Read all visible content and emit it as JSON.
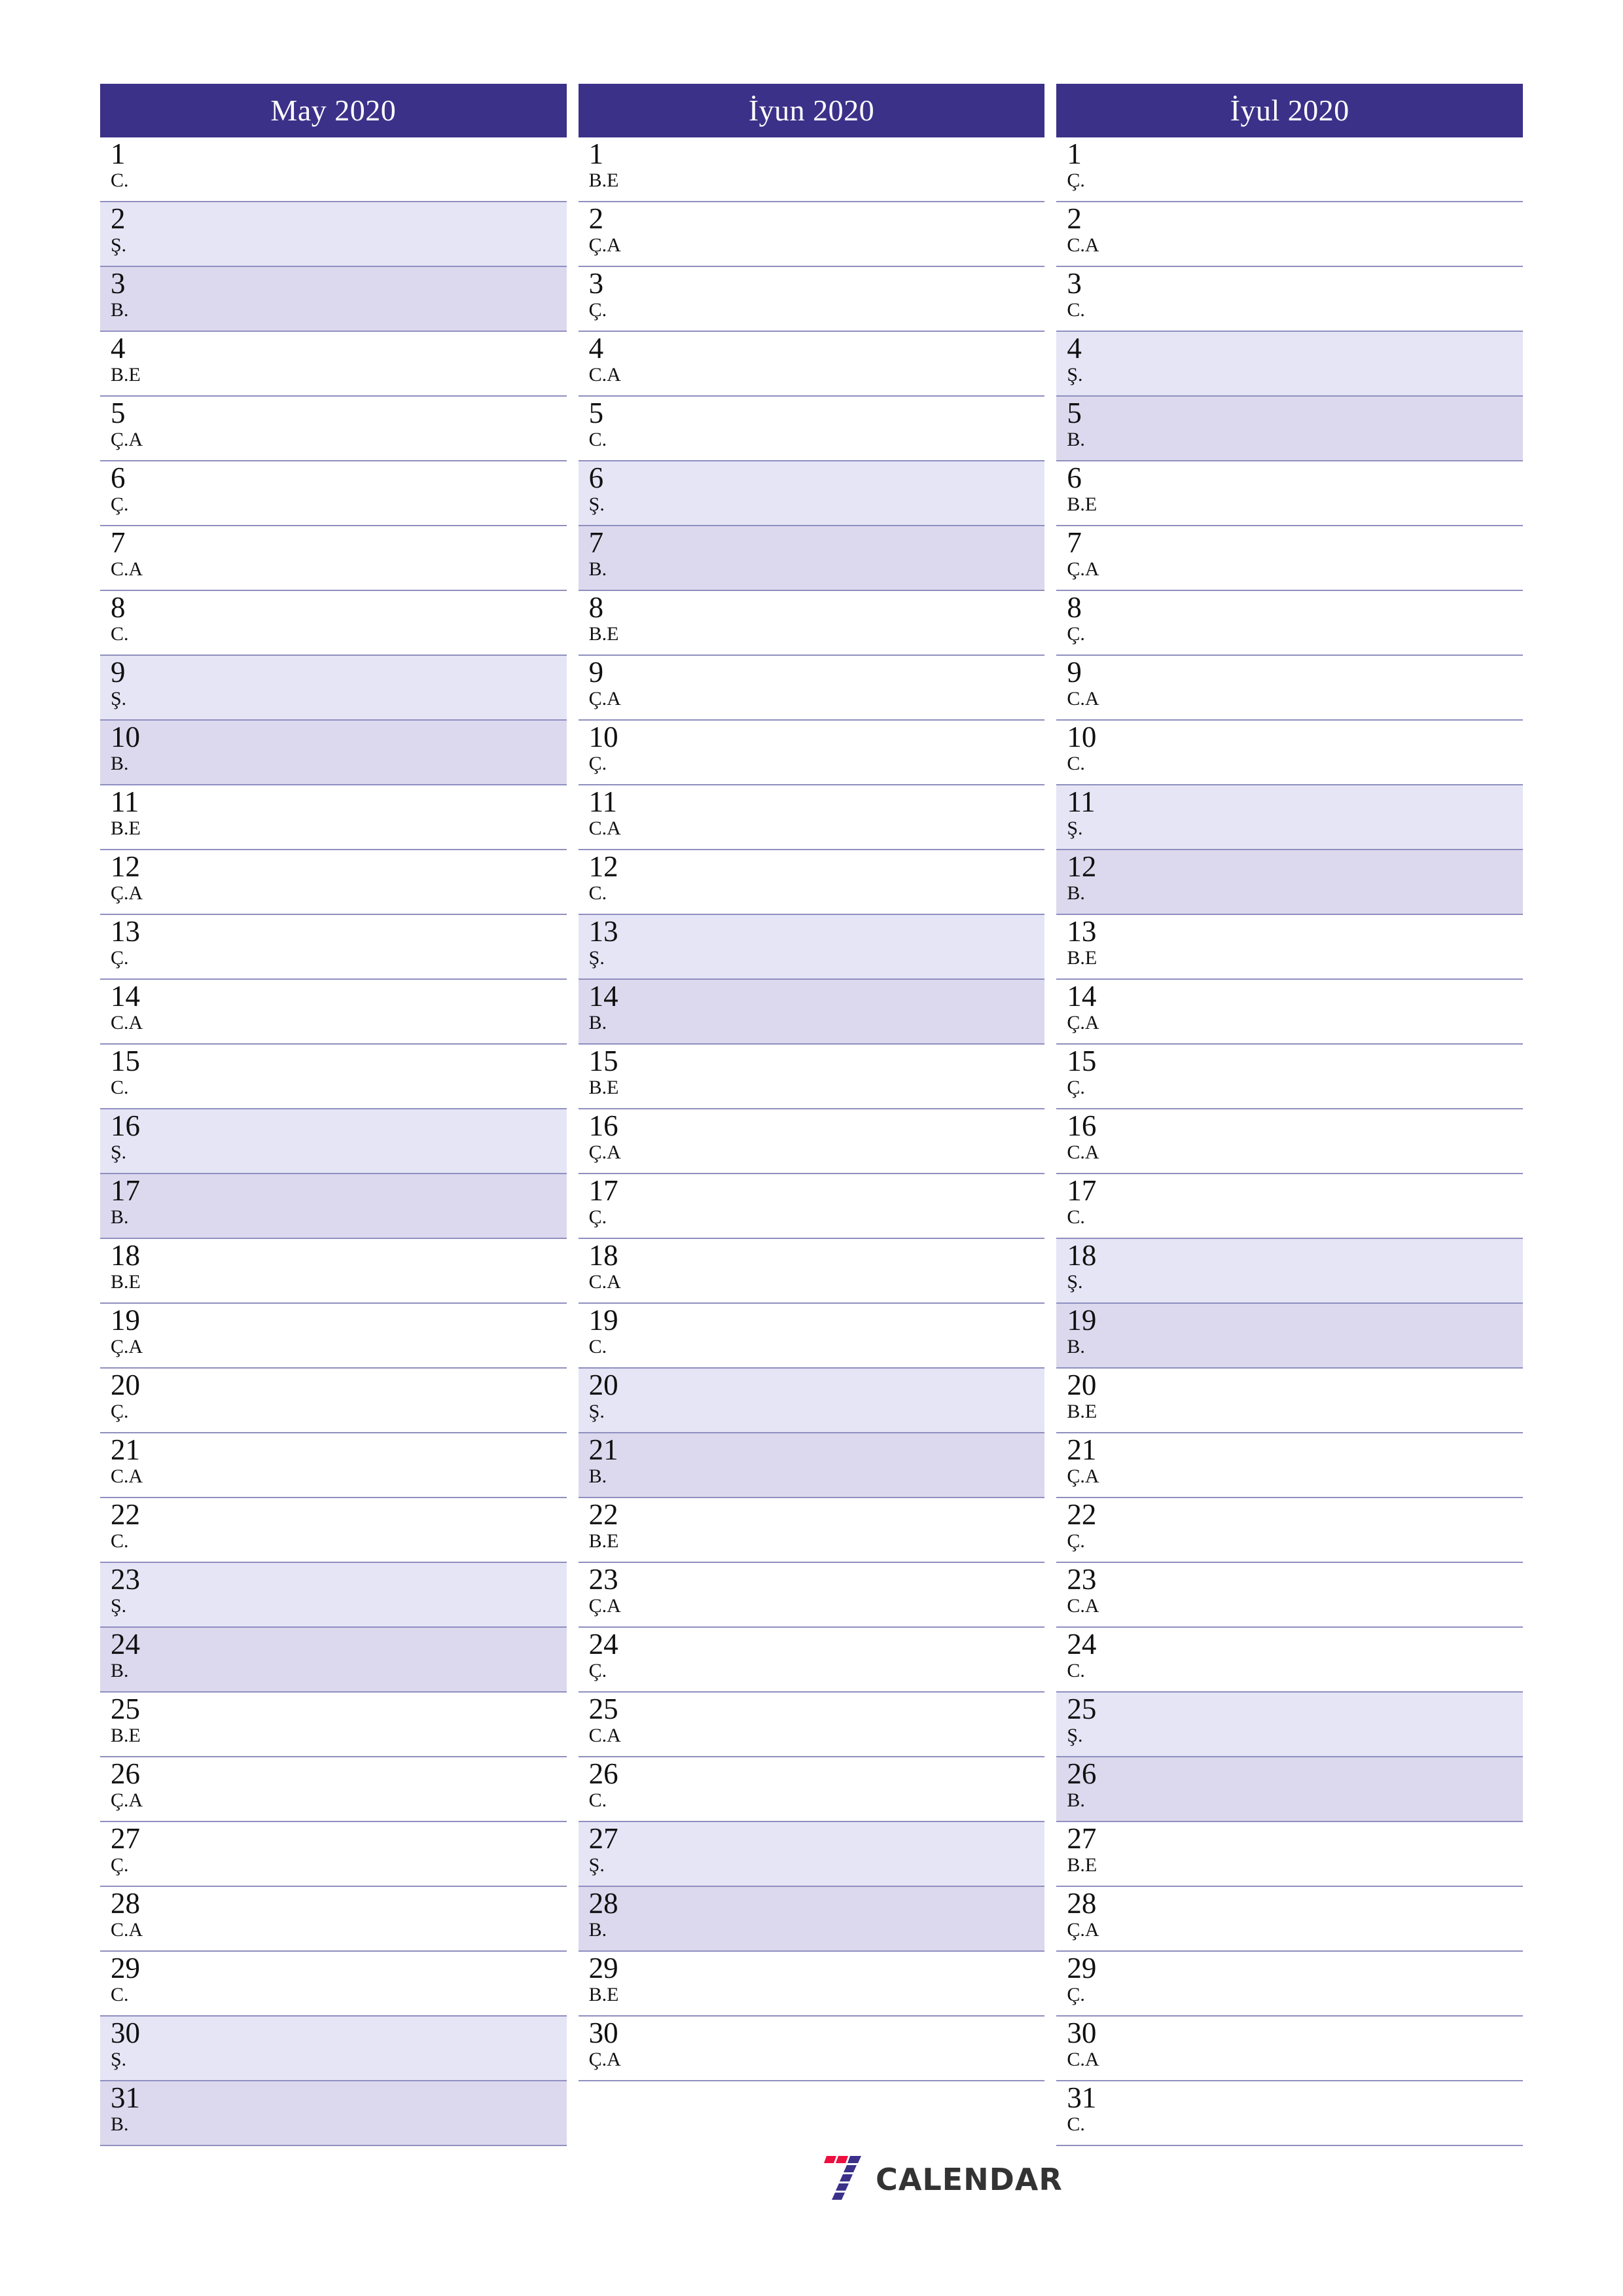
{
  "page": {
    "background_color": "#ffffff",
    "header_color": "#3b3189",
    "saturday_color": "#e5e5f6",
    "sunday_color": "#dcd9ee",
    "separator_color": "#8f8fc0"
  },
  "footer": {
    "logo_text": "CALENDAR",
    "logo_mark_name": "seven-calendar-logo",
    "logo_red": "#ec0f3f",
    "logo_indigo": "#3b3189"
  },
  "months": [
    {
      "title": "May 2020",
      "days": [
        {
          "num": "1",
          "wd": "C.",
          "type": "weekday"
        },
        {
          "num": "2",
          "wd": "Ş.",
          "type": "sat"
        },
        {
          "num": "3",
          "wd": "B.",
          "type": "sun"
        },
        {
          "num": "4",
          "wd": "B.E",
          "type": "weekday"
        },
        {
          "num": "5",
          "wd": "Ç.A",
          "type": "weekday"
        },
        {
          "num": "6",
          "wd": "Ç.",
          "type": "weekday"
        },
        {
          "num": "7",
          "wd": "C.A",
          "type": "weekday"
        },
        {
          "num": "8",
          "wd": "C.",
          "type": "weekday"
        },
        {
          "num": "9",
          "wd": "Ş.",
          "type": "sat"
        },
        {
          "num": "10",
          "wd": "B.",
          "type": "sun"
        },
        {
          "num": "11",
          "wd": "B.E",
          "type": "weekday"
        },
        {
          "num": "12",
          "wd": "Ç.A",
          "type": "weekday"
        },
        {
          "num": "13",
          "wd": "Ç.",
          "type": "weekday"
        },
        {
          "num": "14",
          "wd": "C.A",
          "type": "weekday"
        },
        {
          "num": "15",
          "wd": "C.",
          "type": "weekday"
        },
        {
          "num": "16",
          "wd": "Ş.",
          "type": "sat"
        },
        {
          "num": "17",
          "wd": "B.",
          "type": "sun"
        },
        {
          "num": "18",
          "wd": "B.E",
          "type": "weekday"
        },
        {
          "num": "19",
          "wd": "Ç.A",
          "type": "weekday"
        },
        {
          "num": "20",
          "wd": "Ç.",
          "type": "weekday"
        },
        {
          "num": "21",
          "wd": "C.A",
          "type": "weekday"
        },
        {
          "num": "22",
          "wd": "C.",
          "type": "weekday"
        },
        {
          "num": "23",
          "wd": "Ş.",
          "type": "sat"
        },
        {
          "num": "24",
          "wd": "B.",
          "type": "sun"
        },
        {
          "num": "25",
          "wd": "B.E",
          "type": "weekday"
        },
        {
          "num": "26",
          "wd": "Ç.A",
          "type": "weekday"
        },
        {
          "num": "27",
          "wd": "Ç.",
          "type": "weekday"
        },
        {
          "num": "28",
          "wd": "C.A",
          "type": "weekday"
        },
        {
          "num": "29",
          "wd": "C.",
          "type": "weekday"
        },
        {
          "num": "30",
          "wd": "Ş.",
          "type": "sat"
        },
        {
          "num": "31",
          "wd": "B.",
          "type": "sun"
        }
      ]
    },
    {
      "title": "İyun 2020",
      "days": [
        {
          "num": "1",
          "wd": "B.E",
          "type": "weekday"
        },
        {
          "num": "2",
          "wd": "Ç.A",
          "type": "weekday"
        },
        {
          "num": "3",
          "wd": "Ç.",
          "type": "weekday"
        },
        {
          "num": "4",
          "wd": "C.A",
          "type": "weekday"
        },
        {
          "num": "5",
          "wd": "C.",
          "type": "weekday"
        },
        {
          "num": "6",
          "wd": "Ş.",
          "type": "sat"
        },
        {
          "num": "7",
          "wd": "B.",
          "type": "sun"
        },
        {
          "num": "8",
          "wd": "B.E",
          "type": "weekday"
        },
        {
          "num": "9",
          "wd": "Ç.A",
          "type": "weekday"
        },
        {
          "num": "10",
          "wd": "Ç.",
          "type": "weekday"
        },
        {
          "num": "11",
          "wd": "C.A",
          "type": "weekday"
        },
        {
          "num": "12",
          "wd": "C.",
          "type": "weekday"
        },
        {
          "num": "13",
          "wd": "Ş.",
          "type": "sat"
        },
        {
          "num": "14",
          "wd": "B.",
          "type": "sun"
        },
        {
          "num": "15",
          "wd": "B.E",
          "type": "weekday"
        },
        {
          "num": "16",
          "wd": "Ç.A",
          "type": "weekday"
        },
        {
          "num": "17",
          "wd": "Ç.",
          "type": "weekday"
        },
        {
          "num": "18",
          "wd": "C.A",
          "type": "weekday"
        },
        {
          "num": "19",
          "wd": "C.",
          "type": "weekday"
        },
        {
          "num": "20",
          "wd": "Ş.",
          "type": "sat"
        },
        {
          "num": "21",
          "wd": "B.",
          "type": "sun"
        },
        {
          "num": "22",
          "wd": "B.E",
          "type": "weekday"
        },
        {
          "num": "23",
          "wd": "Ç.A",
          "type": "weekday"
        },
        {
          "num": "24",
          "wd": "Ç.",
          "type": "weekday"
        },
        {
          "num": "25",
          "wd": "C.A",
          "type": "weekday"
        },
        {
          "num": "26",
          "wd": "C.",
          "type": "weekday"
        },
        {
          "num": "27",
          "wd": "Ş.",
          "type": "sat"
        },
        {
          "num": "28",
          "wd": "B.",
          "type": "sun"
        },
        {
          "num": "29",
          "wd": "B.E",
          "type": "weekday"
        },
        {
          "num": "30",
          "wd": "Ç.A",
          "type": "weekday"
        }
      ]
    },
    {
      "title": "İyul 2020",
      "days": [
        {
          "num": "1",
          "wd": "Ç.",
          "type": "weekday"
        },
        {
          "num": "2",
          "wd": "C.A",
          "type": "weekday"
        },
        {
          "num": "3",
          "wd": "C.",
          "type": "weekday"
        },
        {
          "num": "4",
          "wd": "Ş.",
          "type": "sat"
        },
        {
          "num": "5",
          "wd": "B.",
          "type": "sun"
        },
        {
          "num": "6",
          "wd": "B.E",
          "type": "weekday"
        },
        {
          "num": "7",
          "wd": "Ç.A",
          "type": "weekday"
        },
        {
          "num": "8",
          "wd": "Ç.",
          "type": "weekday"
        },
        {
          "num": "9",
          "wd": "C.A",
          "type": "weekday"
        },
        {
          "num": "10",
          "wd": "C.",
          "type": "weekday"
        },
        {
          "num": "11",
          "wd": "Ş.",
          "type": "sat"
        },
        {
          "num": "12",
          "wd": "B.",
          "type": "sun"
        },
        {
          "num": "13",
          "wd": "B.E",
          "type": "weekday"
        },
        {
          "num": "14",
          "wd": "Ç.A",
          "type": "weekday"
        },
        {
          "num": "15",
          "wd": "Ç.",
          "type": "weekday"
        },
        {
          "num": "16",
          "wd": "C.A",
          "type": "weekday"
        },
        {
          "num": "17",
          "wd": "C.",
          "type": "weekday"
        },
        {
          "num": "18",
          "wd": "Ş.",
          "type": "sat"
        },
        {
          "num": "19",
          "wd": "B.",
          "type": "sun"
        },
        {
          "num": "20",
          "wd": "B.E",
          "type": "weekday"
        },
        {
          "num": "21",
          "wd": "Ç.A",
          "type": "weekday"
        },
        {
          "num": "22",
          "wd": "Ç.",
          "type": "weekday"
        },
        {
          "num": "23",
          "wd": "C.A",
          "type": "weekday"
        },
        {
          "num": "24",
          "wd": "C.",
          "type": "weekday"
        },
        {
          "num": "25",
          "wd": "Ş.",
          "type": "sat"
        },
        {
          "num": "26",
          "wd": "B.",
          "type": "sun"
        },
        {
          "num": "27",
          "wd": "B.E",
          "type": "weekday"
        },
        {
          "num": "28",
          "wd": "Ç.A",
          "type": "weekday"
        },
        {
          "num": "29",
          "wd": "Ç.",
          "type": "weekday"
        },
        {
          "num": "30",
          "wd": "C.A",
          "type": "weekday"
        },
        {
          "num": "31",
          "wd": "C.",
          "type": "weekday"
        }
      ]
    }
  ]
}
